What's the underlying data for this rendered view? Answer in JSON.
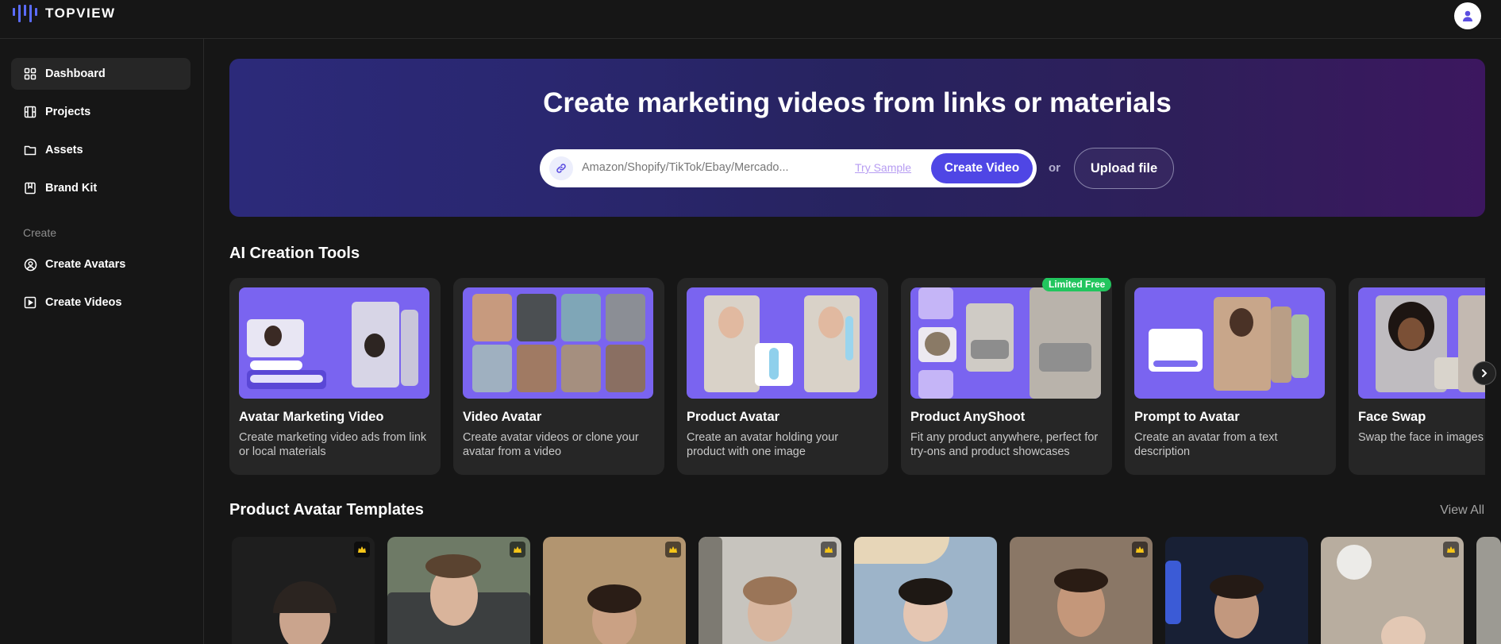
{
  "app": {
    "brand": "TOPVIEW"
  },
  "sidebar": {
    "items": [
      {
        "label": "Dashboard",
        "icon": "grid-icon"
      },
      {
        "label": "Projects",
        "icon": "film-icon"
      },
      {
        "label": "Assets",
        "icon": "folder-icon"
      },
      {
        "label": "Brand Kit",
        "icon": "bookmark-icon"
      }
    ],
    "section_label": "Create",
    "create_items": [
      {
        "label": "Create Avatars",
        "icon": "avatar-icon"
      },
      {
        "label": "Create Videos",
        "icon": "video-icon"
      }
    ]
  },
  "hero": {
    "title": "Create marketing videos from links or materials",
    "input_placeholder": "Amazon/Shopify/TikTok/Ebay/Mercado...",
    "try_sample": "Try Sample",
    "create_button": "Create Video",
    "or": "or",
    "upload_button": "Upload file"
  },
  "tools": {
    "title": "AI Creation Tools",
    "badge": "Limited Free",
    "cards": [
      {
        "title": "Avatar Marketing Video",
        "desc": "Create marketing video ads from link or local materials"
      },
      {
        "title": "Video Avatar",
        "desc": "Create avatar videos or clone your avatar from a video"
      },
      {
        "title": "Product Avatar",
        "desc": "Create an avatar holding your product with one image"
      },
      {
        "title": "Product AnyShoot",
        "desc": "Fit any product anywhere, perfect for try-ons and product showcases"
      },
      {
        "title": "Prompt to Avatar",
        "desc": "Create an avatar from a text description"
      },
      {
        "title": "Face Swap",
        "desc": "Swap the face in images"
      }
    ]
  },
  "templates": {
    "title": "Product Avatar Templates",
    "view_all": "View All"
  }
}
